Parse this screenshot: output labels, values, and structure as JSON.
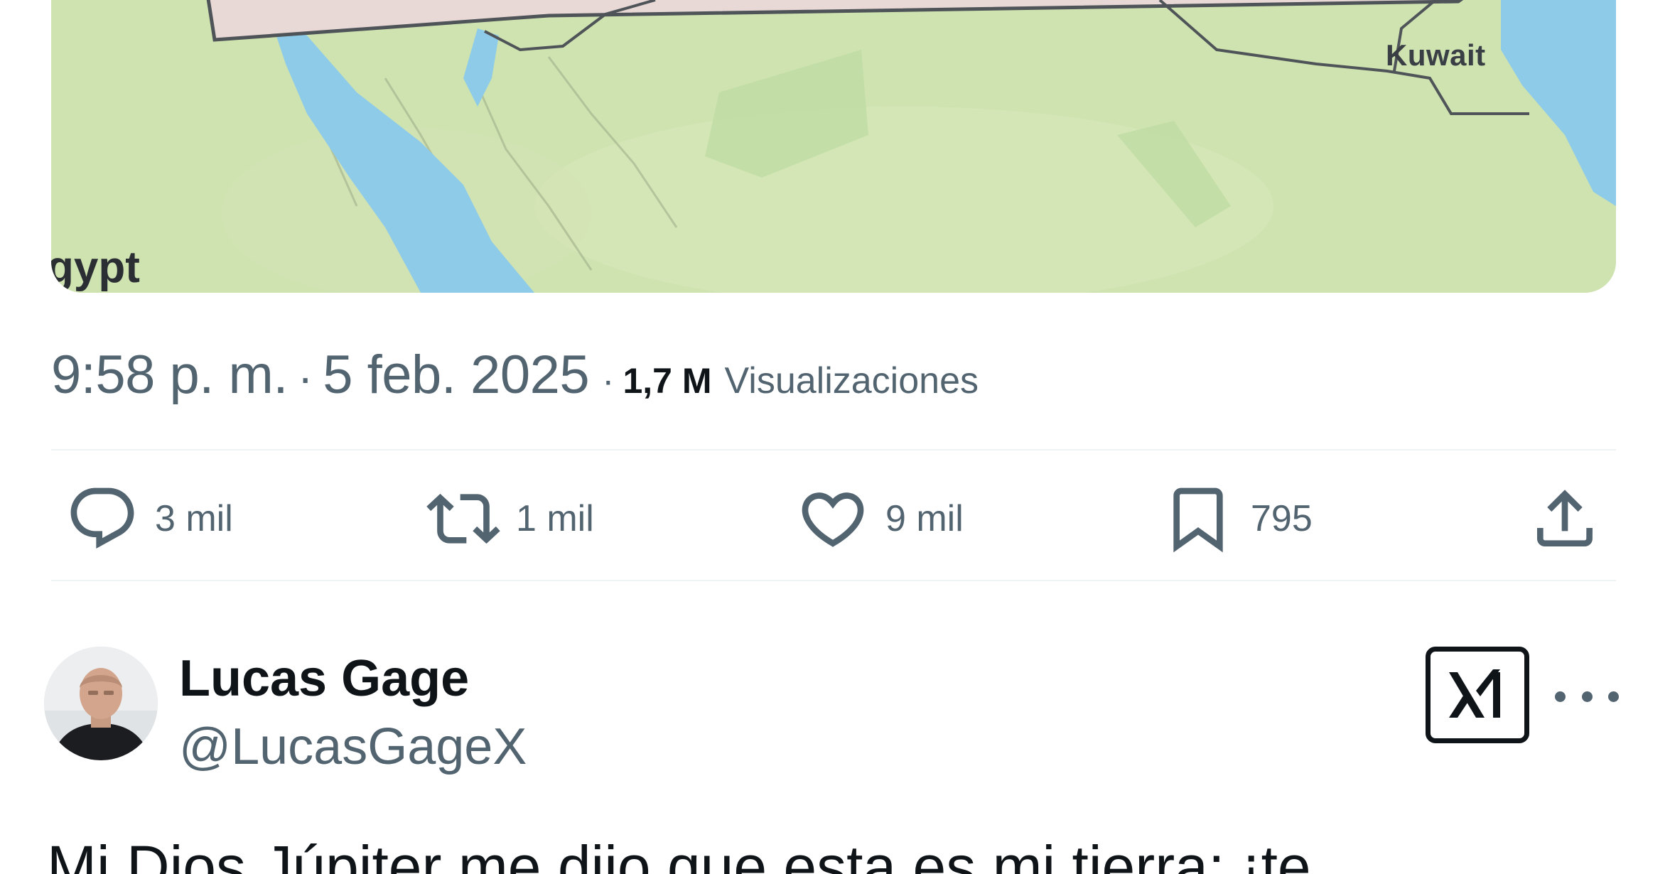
{
  "map": {
    "labels": {
      "kuwait": "Kuwait",
      "egypt": "gypt"
    },
    "colors": {
      "land": "#cfe3b1",
      "water": "#8ecbe8",
      "highlight": "#e9d9d6",
      "border": "#4f5458"
    }
  },
  "tweet": {
    "time": "9:58 p. m.",
    "separator": "·",
    "date": "5 feb. 2025",
    "views_count": "1,7 M",
    "views_label": "Visualizaciones"
  },
  "actions": {
    "replies": {
      "icon": "reply-icon",
      "count": "3 mil"
    },
    "reposts": {
      "icon": "repost-icon",
      "count": "1 mil"
    },
    "likes": {
      "icon": "heart-icon",
      "count": "9 mil"
    },
    "bookmarks": {
      "icon": "bookmark-icon",
      "count": "795"
    },
    "share": {
      "icon": "share-icon"
    }
  },
  "reply_post": {
    "author_name": "Lucas Gage",
    "author_handle": "@LucasGageX",
    "grok_icon": "grok-icon",
    "more_icon": "more-icon",
    "text": "Mi Dios Júpiter me dijo que esta es mi tierra; ¡te"
  },
  "colors": {
    "text": "#0f1419",
    "secondary": "#536471",
    "divider": "#eff3f4"
  }
}
